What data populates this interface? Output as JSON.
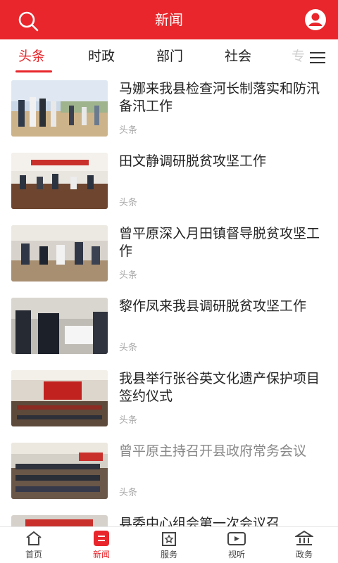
{
  "header": {
    "title": "新闻",
    "search_icon": "search-icon",
    "user_icon": "user-icon"
  },
  "tabs": [
    {
      "label": "头条",
      "active": true
    },
    {
      "label": "时政",
      "active": false
    },
    {
      "label": "部门",
      "active": false
    },
    {
      "label": "社会",
      "active": false
    },
    {
      "label": "专",
      "active": false
    }
  ],
  "menu_icon": "menu-icon",
  "news": [
    {
      "title": "马娜来我县检查河长制落实和防汛备汛工作",
      "source": "头条",
      "read": false
    },
    {
      "title": "田文静调研脱贫攻坚工作",
      "source": "头条",
      "read": false
    },
    {
      "title": "曾平原深入月田镇督导脱贫攻坚工作",
      "source": "头条",
      "read": false
    },
    {
      "title": "黎作凤来我县调研脱贫攻坚工作",
      "source": "头条",
      "read": false
    },
    {
      "title": "我县举行张谷英文化遗产保护项目签约仪式",
      "source": "头条",
      "read": false
    },
    {
      "title": "曾平原主持召开县政府常务会议",
      "source": "头条",
      "read": true
    },
    {
      "title": "县委中心组会第一次会议召",
      "source": "",
      "read": false
    }
  ],
  "bottom_nav": [
    {
      "label": "首页",
      "icon": "home-icon",
      "active": false
    },
    {
      "label": "新闻",
      "icon": "news-icon",
      "active": true
    },
    {
      "label": "服务",
      "icon": "service-icon",
      "active": false
    },
    {
      "label": "视听",
      "icon": "video-icon",
      "active": false
    },
    {
      "label": "政务",
      "icon": "government-icon",
      "active": false
    }
  ],
  "colors": {
    "brand": "#e8262b",
    "text": "#222222",
    "muted": "#aaaaaa"
  }
}
